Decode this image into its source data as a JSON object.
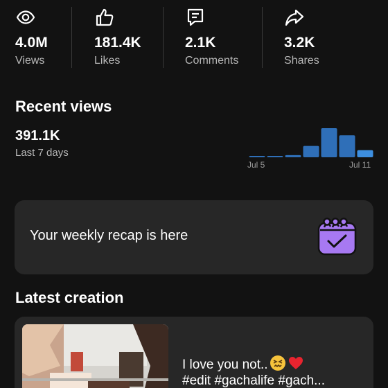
{
  "stats": [
    {
      "value": "4.0M",
      "label": "Views",
      "icon": "eye-icon"
    },
    {
      "value": "181.4K",
      "label": "Likes",
      "icon": "thumbs-up-icon"
    },
    {
      "value": "2.1K",
      "label": "Comments",
      "icon": "comment-icon"
    },
    {
      "value": "3.2K",
      "label": "Shares",
      "icon": "share-icon"
    }
  ],
  "recent_views": {
    "title": "Recent views",
    "value": "391.1K",
    "period": "Last 7 days",
    "x_start_label": "Jul 5",
    "x_end_label": "Jul 11"
  },
  "chart_data": {
    "type": "bar",
    "categories": [
      "Jul 5",
      "Jul 6",
      "Jul 7",
      "Jul 8",
      "Jul 9",
      "Jul 10",
      "Jul 11"
    ],
    "values": [
      2,
      2,
      3,
      16,
      41,
      31,
      10
    ],
    "colors": [
      "#2f6fb8",
      "#2f6fb8",
      "#2f6fb8",
      "#2f6fb8",
      "#2f6fb8",
      "#2f6fb8",
      "#3d8fe0"
    ]
  },
  "recap": {
    "text": "Your weekly recap is here",
    "icon": "calendar-check-icon",
    "accent": "#a779f2"
  },
  "latest_creation": {
    "title": "Latest creation",
    "caption_line1": "I love you not..",
    "caption_line2": "#edit #gachalife #gach...",
    "emojis": [
      "confounded-face-icon",
      "red-heart-icon"
    ]
  }
}
